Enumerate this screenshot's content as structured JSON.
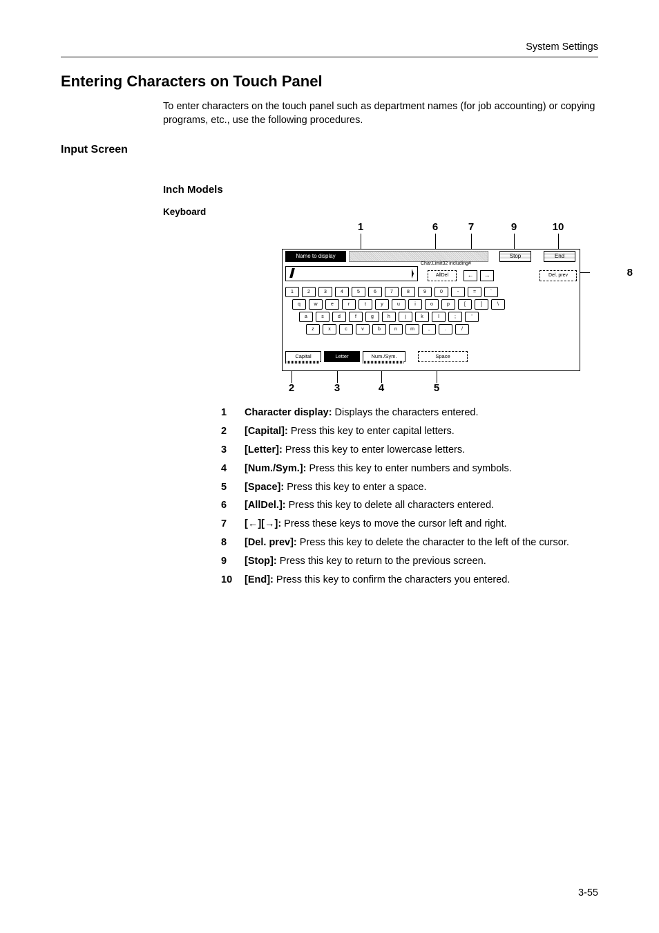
{
  "running_head": "System Settings",
  "h1": "Entering Characters on Touch Panel",
  "intro": "To enter characters on the touch panel such as department names (for job accounting) or copying programs, etc., use the following procedures.",
  "h2": "Input Screen",
  "h3": "Inch Models",
  "h4": "Keyboard",
  "callouts_top": {
    "c1": "1",
    "c6": "6",
    "c7": "7",
    "c9": "9",
    "c10": "10"
  },
  "callouts_bottom": {
    "c2": "2",
    "c3": "3",
    "c4": "4",
    "c5": "5"
  },
  "callout_side": "8",
  "panel": {
    "name_to_display": "Name to display",
    "stop": "Stop",
    "end": "End",
    "char_limit": "Char.Limit32 including#",
    "alldel": "AllDel",
    "left": "←",
    "right": "→",
    "delprev": "Del. prev",
    "row1": [
      "1",
      "2",
      "3",
      "4",
      "5",
      "6",
      "7",
      "8",
      "9",
      "0",
      "-",
      "=",
      "`"
    ],
    "row2": [
      "q",
      "w",
      "e",
      "r",
      "t",
      "y",
      "u",
      "i",
      "o",
      "p",
      "[",
      "]",
      "\\"
    ],
    "row3": [
      "a",
      "s",
      "d",
      "f",
      "g",
      "h",
      "j",
      "k",
      "l",
      ";",
      "'"
    ],
    "row4": [
      "z",
      "x",
      "c",
      "v",
      "b",
      "n",
      "m",
      ",",
      ".",
      "/"
    ],
    "capital": "Capital",
    "letter": "Letter",
    "numsym": "Num./Sym.",
    "space": "Space"
  },
  "legend": [
    {
      "n": "1",
      "label": "Character display:",
      "desc": " Displays the characters entered."
    },
    {
      "n": "2",
      "label": "[Capital]:",
      "desc": " Press this key to enter capital letters."
    },
    {
      "n": "3",
      "label": "[Letter]:",
      "desc": " Press this key to enter lowercase letters."
    },
    {
      "n": "4",
      "label": "[Num./Sym.]:",
      "desc": " Press this key to enter numbers and symbols."
    },
    {
      "n": "5",
      "label": "[Space]:",
      "desc": " Press this key to enter a space."
    },
    {
      "n": "6",
      "label": "[AllDel.]:",
      "desc": " Press this key to delete all characters entered."
    },
    {
      "n": "7",
      "label": "[←][→]:",
      "desc": " Press these keys to move the cursor left and right."
    },
    {
      "n": "8",
      "label": "[Del. prev]:",
      "desc": " Press this key to delete the character to the left of the cursor."
    },
    {
      "n": "9",
      "label": "[Stop]:",
      "desc": " Press this key to return to the previous screen."
    },
    {
      "n": "10",
      "label": "[End]:",
      "desc": " Press this key to confirm the characters you entered."
    }
  ],
  "page_number": "3-55"
}
